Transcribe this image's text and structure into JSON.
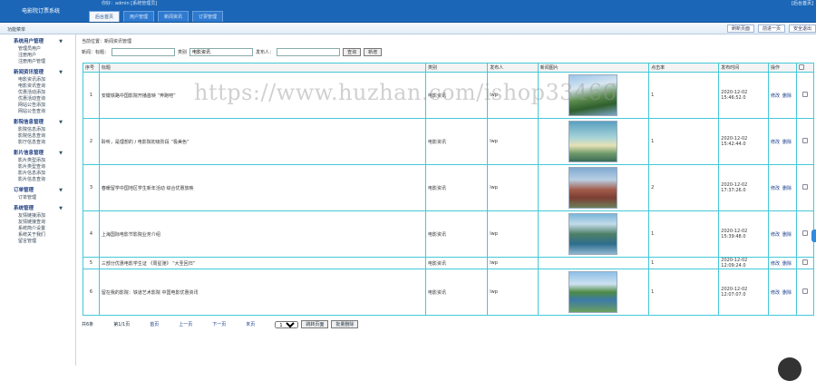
{
  "header": {
    "brand": "电影院订票系统",
    "info": "你好：admin [系统管理员]",
    "right": "[后台首页]"
  },
  "tabs": [
    "后台首页",
    "用户管理",
    "新闻资讯",
    "订票管理"
  ],
  "subbar": {
    "title": "功能菜单",
    "buttons": [
      "刷新页面",
      "前进一页",
      "安全退出"
    ]
  },
  "sidebar": [
    {
      "title": "系统用户管理",
      "items": [
        "管理员用户",
        "注册用户",
        "注册用户管理"
      ]
    },
    {
      "title": "新闻资讯管理",
      "items": [
        "电影资讯添加",
        "电影资讯查询",
        "优惠活动添加",
        "优惠活动查询",
        "网站公告添加",
        "网站公告查询"
      ]
    },
    {
      "title": "影院信息管理",
      "items": [
        "影院信息添加",
        "影院信息查询",
        "影厅信息查询"
      ]
    },
    {
      "title": "影片信息管理",
      "items": [
        "影片类型添加",
        "影片类型查询",
        "影片信息添加",
        "影片信息查询"
      ]
    },
    {
      "title": "订单管理",
      "items": [
        "订单管理"
      ]
    },
    {
      "title": "系统管理",
      "items": [
        "友情链接添加",
        "友情链接查询",
        "系统简介设置",
        "系统关于我们",
        "留言管理"
      ]
    }
  ],
  "main": {
    "section_title": "当前位置：新闻资讯管理",
    "search": {
      "title_label": "新闻：标题：",
      "title_value": "",
      "type_label": "类别",
      "type_value": "电影资讯",
      "author_label": "发布人：",
      "author_value": "",
      "query_btn": "查询",
      "add_btn": "新增"
    },
    "columns": [
      "序号",
      "标题",
      "类别",
      "发布人",
      "新闻图片",
      "点击率",
      "发布时间",
      "操作",
      ""
    ],
    "rows": [
      {
        "idx": "1",
        "title": "安徽铁路中国影院开播首映 “奔跑吧”",
        "type": "电影资讯",
        "author": "lwp",
        "img": "t1",
        "hits": "1",
        "time": "2020-12-02 15:46:52.0",
        "edit": "修改",
        "del": "删除"
      },
      {
        "idx": "2",
        "title": "聆听，是理想的 / 电影院初级阶段 “极美色”",
        "type": "电影资讯",
        "author": "lwp",
        "img": "t2",
        "hits": "1",
        "time": "2020-12-02 15:42:44.0",
        "edit": "修改",
        "del": "删除"
      },
      {
        "idx": "3",
        "title": "春暖留学中国地区学生新年活动 综合优惠放映",
        "type": "电影资讯",
        "author": "lwp",
        "img": "t3",
        "hits": "2",
        "time": "2020-12-02 17:37:26.0",
        "edit": "修改",
        "del": "删除"
      },
      {
        "idx": "4",
        "title": "上海国际电影节影院业务介绍",
        "type": "电影资讯",
        "author": "lwp",
        "img": "t4",
        "hits": "1",
        "time": "2020-12-02 15:39:48.0",
        "edit": "修改",
        "del": "删除"
      },
      {
        "idx": "5",
        "title": "三部分优惠电影学生证 《周星驰》 “大圣回归”",
        "type": "电影资讯",
        "author": "lwp",
        "img": "",
        "hits": "1",
        "time": "2020-12-02 12:09:24.0",
        "edit": "修改",
        "del": "删除"
      },
      {
        "idx": "6",
        "title": "留在我的影院：铁道艺术影院 中国电影优惠资讯",
        "type": "电影资讯",
        "author": "lwp",
        "img": "t5",
        "hits": "1",
        "time": "2020-12-02 12:07:07.0",
        "edit": "修改",
        "del": "删除"
      }
    ],
    "pager": {
      "total": "共6条",
      "page_info": "第1/1页",
      "first": "首页",
      "prev": "上一页",
      "next": "下一页",
      "last": "末页",
      "select_value": "1",
      "go_btn": "跳转页面",
      "del_btn": "批量删除"
    },
    "watermark": "https://www.huzhan.com/ishop33466"
  }
}
